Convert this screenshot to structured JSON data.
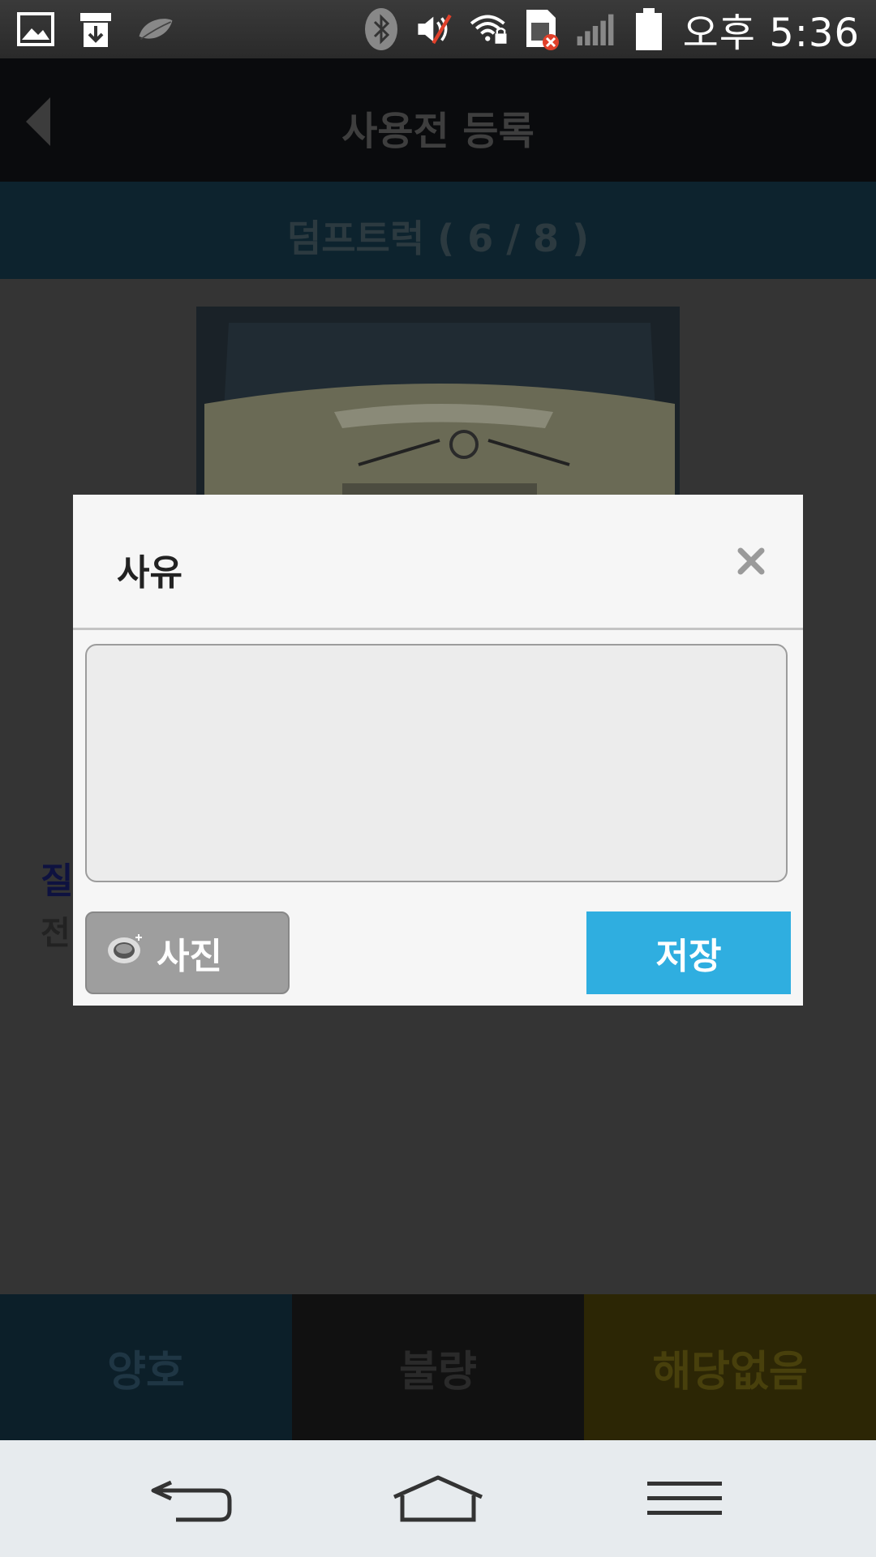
{
  "status_bar": {
    "time": "오후 5:36",
    "icons": [
      "image-icon",
      "download-icon",
      "leaf-icon",
      "bluetooth-icon",
      "mute-icon",
      "wifi-lock-icon",
      "sim-error-icon",
      "signal-icon",
      "battery-icon"
    ]
  },
  "app_bar": {
    "title": "사용전 등록",
    "back_icon": "chevron-left-icon"
  },
  "sub_bar": {
    "title": "덤프트럭 ( 6 / 8 )"
  },
  "background": {
    "label_1": "질",
    "label_2": "전"
  },
  "bottom_buttons": {
    "good": "양호",
    "bad": "불량",
    "not_applicable": "해당없음"
  },
  "dialog": {
    "title": "사유",
    "textarea_value": "",
    "photo_button": "사진",
    "save_button": "저장",
    "accent_color": "#2faee0"
  },
  "nav_bar": {
    "icons": [
      "back-arrow-icon",
      "home-icon",
      "menu-icon"
    ]
  }
}
